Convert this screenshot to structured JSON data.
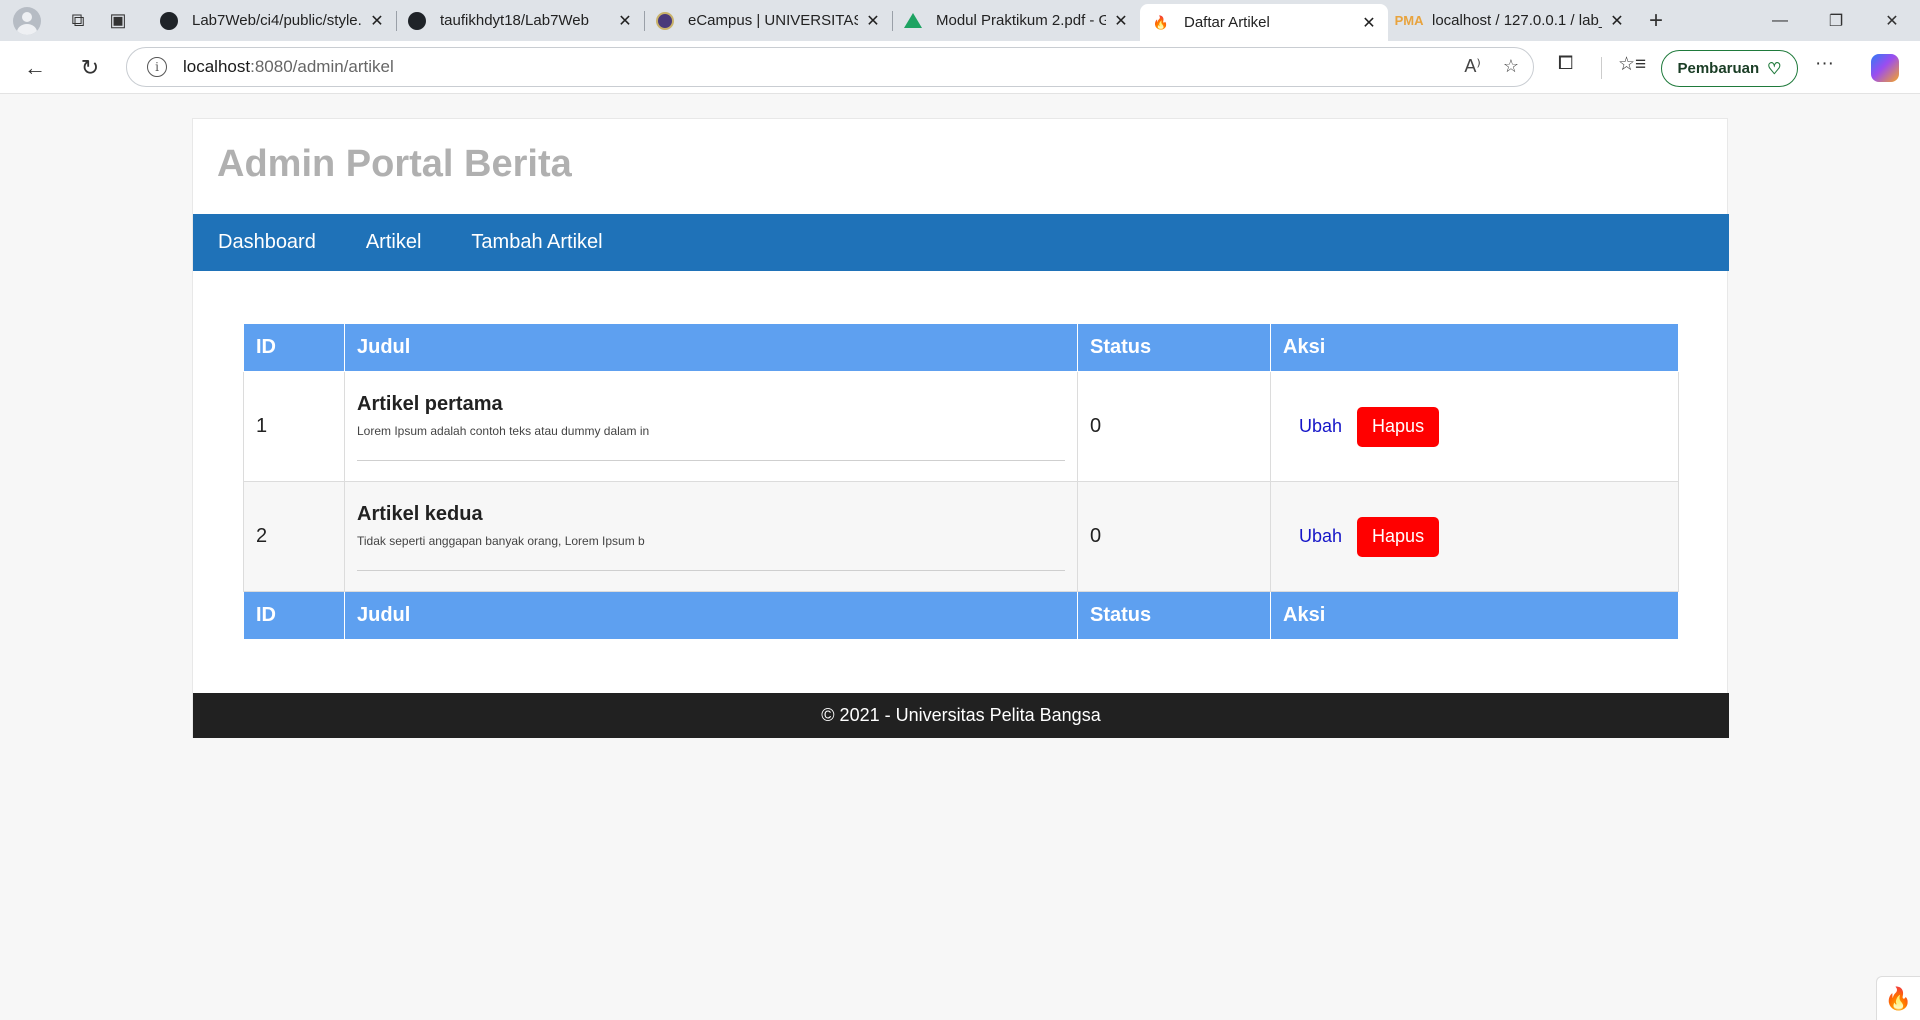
{
  "browser": {
    "tabs": [
      {
        "title": "Lab7Web/ci4/public/style.",
        "favicon": "github-icon",
        "active": false
      },
      {
        "title": "taufikhdyt18/Lab7Web",
        "favicon": "github-icon",
        "active": false
      },
      {
        "title": "eCampus | UNIVERSITAS P",
        "favicon": "university-icon",
        "active": false
      },
      {
        "title": "Modul Praktikum 2.pdf - G",
        "favicon": "google-drive-icon",
        "active": false
      },
      {
        "title": "Daftar Artikel",
        "favicon": "codeigniter-flame-icon",
        "active": true
      },
      {
        "title": "localhost / 127.0.0.1 / lab_",
        "favicon": "phpmyadmin-icon",
        "active": false
      }
    ],
    "url_host": "localhost",
    "url_rest": ":8080/admin/artikel",
    "update_button": "Pembaruan"
  },
  "site": {
    "title": "Admin Portal Berita",
    "nav": [
      "Dashboard",
      "Artikel",
      "Tambah Artikel"
    ]
  },
  "table": {
    "headers": [
      "ID",
      "Judul",
      "Status",
      "Aksi"
    ],
    "rows": [
      {
        "id": "1",
        "title": "Artikel pertama",
        "excerpt": "Lorem Ipsum adalah contoh teks atau dummy dalam in",
        "status": "0",
        "edit": "Ubah",
        "delete": "Hapus"
      },
      {
        "id": "2",
        "title": "Artikel kedua",
        "excerpt": "Tidak seperti anggapan banyak orang, Lorem Ipsum b",
        "status": "0",
        "edit": "Ubah",
        "delete": "Hapus"
      }
    ]
  },
  "footer": "© 2021 - Universitas Pelita Bangsa",
  "colors": {
    "navbar": "#1f72b8",
    "table_header": "#5ea0f0",
    "delete_button": "#ff0000",
    "footer": "#212121"
  }
}
